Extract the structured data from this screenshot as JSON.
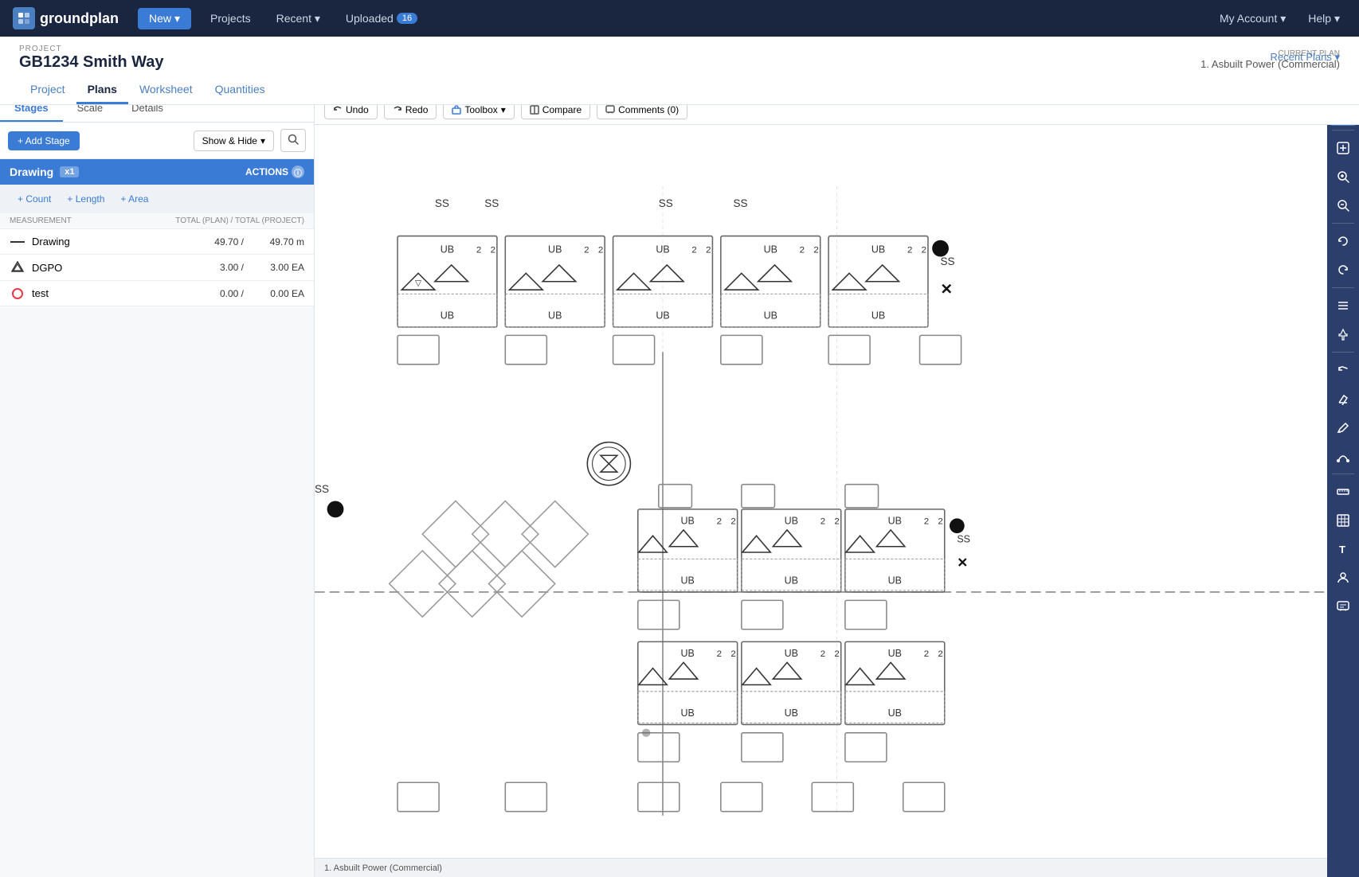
{
  "app": {
    "logo_text": "groundplan"
  },
  "topnav": {
    "new_label": "New",
    "projects_label": "Projects",
    "recent_label": "Recent",
    "uploaded_label": "Uploaded",
    "uploaded_count": "16",
    "my_account_label": "My Account",
    "help_label": "Help"
  },
  "project": {
    "label": "PROJECT",
    "title": "GB1234 Smith Way",
    "tabs": [
      {
        "id": "project",
        "label": "Project"
      },
      {
        "id": "plans",
        "label": "Plans"
      },
      {
        "id": "worksheet",
        "label": "Worksheet"
      },
      {
        "id": "quantities",
        "label": "Quantities"
      }
    ],
    "active_tab": "project",
    "current_plan_label": "CURRENT PLAN",
    "current_plan": "1. Asbuilt Power (Commercial)",
    "recent_plans_label": "Recent Plans"
  },
  "sidebar": {
    "tabs": [
      {
        "id": "stages",
        "label": "Stages"
      },
      {
        "id": "scale",
        "label": "Scale"
      },
      {
        "id": "details",
        "label": "Details"
      }
    ],
    "active_tab": "stages",
    "add_stage_label": "+ Add Stage",
    "show_hide_label": "Show & Hide",
    "drawing_label": "Drawing",
    "x1_badge": "x1",
    "actions_label": "ACTIONS",
    "count_label": "+ Count",
    "length_label": "+ Length",
    "area_label": "+ Area",
    "measurement_header_left": "MEASUREMENT",
    "measurement_header_plan": "TOTAL (PLAN) /",
    "measurement_header_project": "TOTAL (PROJECT)",
    "rows": [
      {
        "id": "drawing",
        "icon": "line",
        "icon_color": "#333",
        "name": "Drawing",
        "plan_val": "49.70",
        "plan_unit": "/",
        "project_val": "49.70",
        "project_unit": "m"
      },
      {
        "id": "dgpo",
        "icon": "marker",
        "icon_color": "#333",
        "name": "DGPO",
        "plan_val": "3.00",
        "plan_unit": "/",
        "project_val": "3.00",
        "project_unit": "EA"
      },
      {
        "id": "test",
        "icon": "circle",
        "icon_color": "#e63946",
        "name": "test",
        "plan_val": "0.00",
        "plan_unit": "/",
        "project_val": "0.00",
        "project_unit": "EA"
      }
    ]
  },
  "toolbar": {
    "undo_label": "Undo",
    "redo_label": "Redo",
    "toolbox_label": "Toolbox",
    "compare_label": "Compare",
    "comments_label": "Comments (0)"
  },
  "bottom_bar": {
    "plan_name": "1. Asbuilt Power (Commercial)"
  },
  "right_panel_icons": [
    "layers-icon",
    "zoom-fit-icon",
    "zoom-in-icon",
    "zoom-out-icon",
    "rotate-ccw-icon",
    "rotate-cw-icon",
    "list-icon",
    "pin-icon",
    "undo2-icon",
    "eraser-icon",
    "pencil-icon",
    "curve-icon",
    "pen-icon",
    "grid-icon",
    "text-icon",
    "person-icon",
    "chat-icon"
  ]
}
